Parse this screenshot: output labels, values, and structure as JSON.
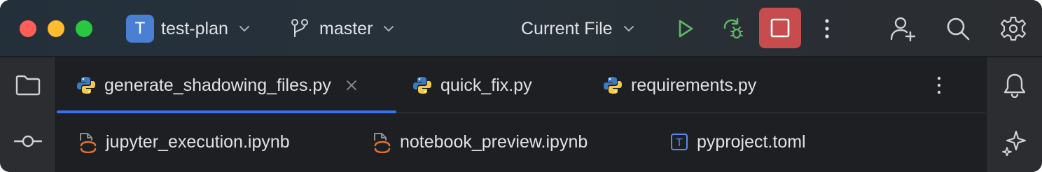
{
  "titlebar": {
    "project": {
      "badge": "T",
      "name": "test-plan"
    },
    "branch": {
      "name": "master"
    },
    "run_config": {
      "name": "Current File"
    }
  },
  "tabs": {
    "row1": [
      {
        "label": "generate_shadowing_files.py",
        "icon": "python-icon",
        "active": true
      },
      {
        "label": "quick_fix.py",
        "icon": "python-icon"
      },
      {
        "label": "requirements.py",
        "icon": "python-icon"
      }
    ],
    "row2": [
      {
        "label": "jupyter_execution.ipynb",
        "icon": "jupyter-notebook-icon"
      },
      {
        "label": "notebook_preview.ipynb",
        "icon": "jupyter-notebook-icon"
      },
      {
        "label": "pyproject.toml",
        "icon": "toml-icon",
        "badge": "T"
      }
    ]
  },
  "colors": {
    "accent": "#3574f0",
    "stop": "#c74c4e",
    "run": "#5fb865",
    "project_badge": "#4a80d4"
  }
}
